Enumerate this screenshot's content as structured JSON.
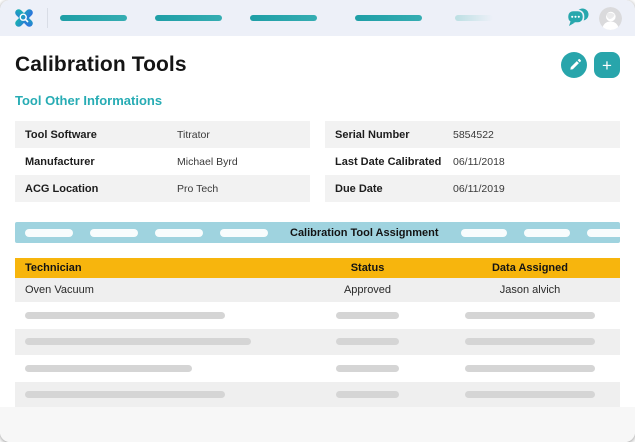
{
  "page": {
    "title": "Calibration Tools",
    "section_title": "Tool Other Informations"
  },
  "info": {
    "left": [
      {
        "label": "Tool Software",
        "value": "Titrator"
      },
      {
        "label": "Manufacturer",
        "value": "Michael Byrd"
      },
      {
        "label": "ACG Location",
        "value": "Pro Tech"
      }
    ],
    "right": [
      {
        "label": "Serial Number",
        "value": "5854522"
      },
      {
        "label": "Last Date Calibrated",
        "value": "06/11/2018"
      },
      {
        "label": "Due Date",
        "value": "06/11/2019"
      }
    ]
  },
  "assignment": {
    "banner_title": "Calibration Tool Assignment",
    "columns": [
      "Technician",
      "Status",
      "Data Assigned"
    ],
    "rows": [
      [
        "Oven Vacuum",
        "Approved",
        "Jason alvich"
      ]
    ]
  },
  "toolbar": {
    "add_label": "+"
  },
  "icons": {
    "edit": "pencil-icon",
    "add": "plus-icon",
    "messages": "chat-bubbles-icon",
    "profile": "user-avatar"
  },
  "colors": {
    "accent_teal": "#28A5AB",
    "heading_teal": "#27ACB4",
    "banner_teal": "#9FD3DF",
    "header_yellow": "#F7B50D",
    "topbar_bg": "#EDF0F8"
  }
}
